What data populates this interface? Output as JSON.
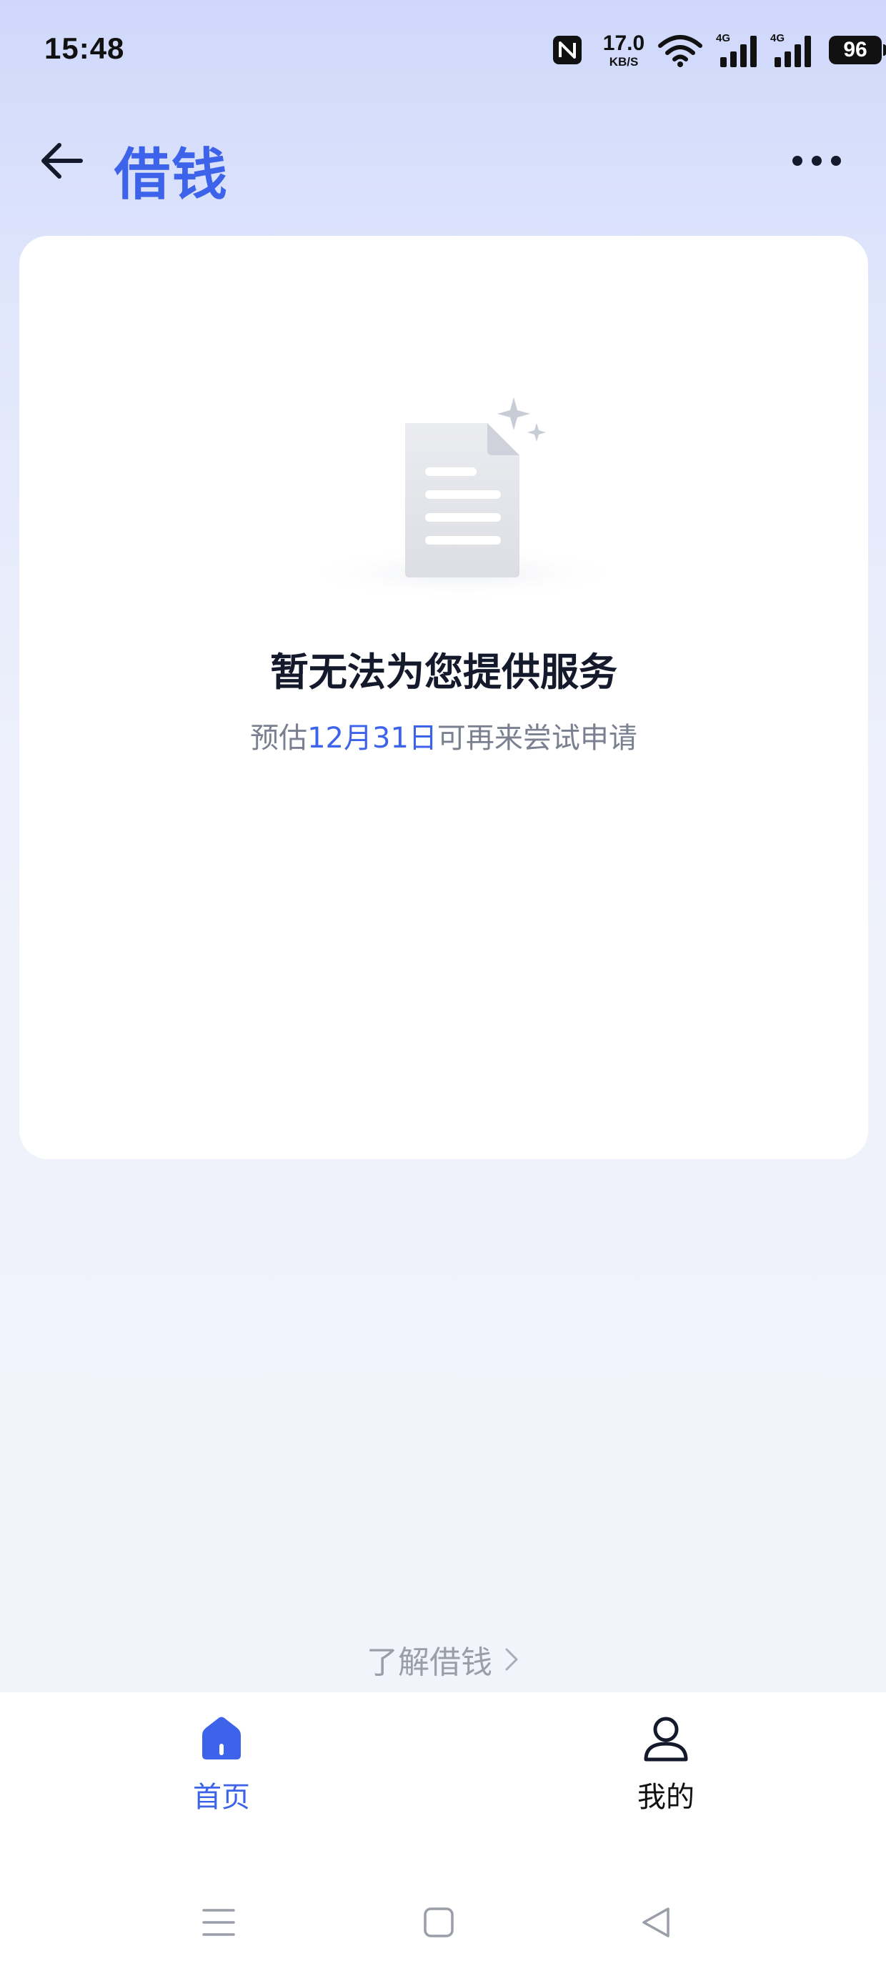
{
  "status_bar": {
    "time": "15:48",
    "net_speed_value": "17.0",
    "net_speed_unit": "KB/S",
    "signal1_label": "4G",
    "signal2_label": "4G",
    "battery": "96"
  },
  "header": {
    "title": "借钱"
  },
  "empty_state": {
    "title": "暂无法为您提供服务",
    "subtitle_prefix": "预估",
    "subtitle_date": "12月31日",
    "subtitle_suffix": "可再来尝试申请"
  },
  "learn_more": {
    "label": "了解借钱"
  },
  "bottom_nav": {
    "items": [
      {
        "label": "首页",
        "icon": "home-icon",
        "active": true
      },
      {
        "label": "我的",
        "icon": "person-icon",
        "active": false
      }
    ]
  },
  "colors": {
    "accent": "#3d63ea",
    "title_text": "#141a2b",
    "muted_text": "#7b8090"
  }
}
